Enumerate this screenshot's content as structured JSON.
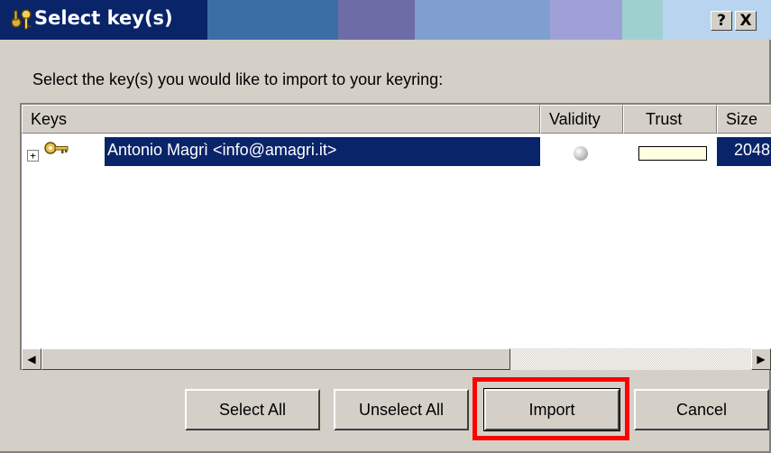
{
  "window": {
    "title": "Select key(s)",
    "help_label": "?",
    "close_label": "X"
  },
  "prompt": "Select the key(s) you would like to import to your keyring:",
  "list": {
    "columns": [
      "Keys",
      "Validity",
      "Trust",
      "Size"
    ],
    "rows": [
      {
        "expander": "+",
        "name": "Antonio Magrì <info@amagri.it>",
        "size": "2048,",
        "selected": true
      }
    ]
  },
  "buttons": {
    "select_all": "Select All",
    "unselect_all": "Unselect All",
    "import": "Import",
    "cancel": "Cancel"
  },
  "scrollbar": {
    "left_arrow": "◀",
    "right_arrow": "▶"
  },
  "colors": {
    "selection": "#0a246a",
    "highlight_box": "#ff0000",
    "trust_bar": "#ffffe1"
  },
  "icons": {
    "title": "key-pair-icon",
    "row": "key-icon",
    "validity": "validity-dot-icon"
  }
}
